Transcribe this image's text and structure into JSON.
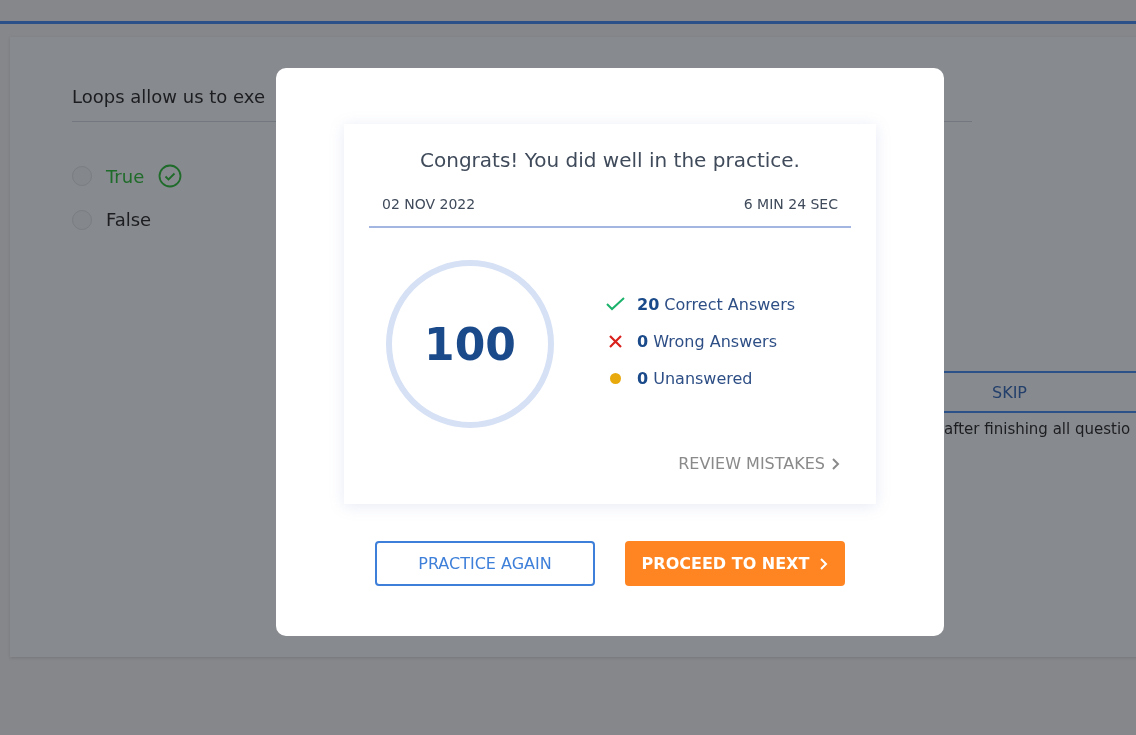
{
  "question": {
    "text": "Loops allow us to exe",
    "options": [
      {
        "label": "True",
        "selected": false,
        "correct": true
      },
      {
        "label": "False",
        "selected": false,
        "correct": false
      }
    ]
  },
  "skip": {
    "label": "SKIP",
    "note": "after finishing all questio"
  },
  "result": {
    "title": "Congrats! You did well in the practice.",
    "date": "02 NOV 2022",
    "duration": "6 MIN 24 SEC",
    "score": "100",
    "stats": [
      {
        "kind": "correct",
        "count": "20",
        "label": "Correct Answers"
      },
      {
        "kind": "wrong",
        "count": "0",
        "label": "Wrong Answers"
      },
      {
        "kind": "unanswered",
        "count": "0",
        "label": "Unanswered"
      }
    ],
    "review": "REVIEW MISTAKES",
    "buttons": [
      {
        "kind": "secondary",
        "label": "PRACTICE AGAIN"
      },
      {
        "kind": "primary",
        "label": "PROCEED TO NEXT"
      }
    ]
  }
}
